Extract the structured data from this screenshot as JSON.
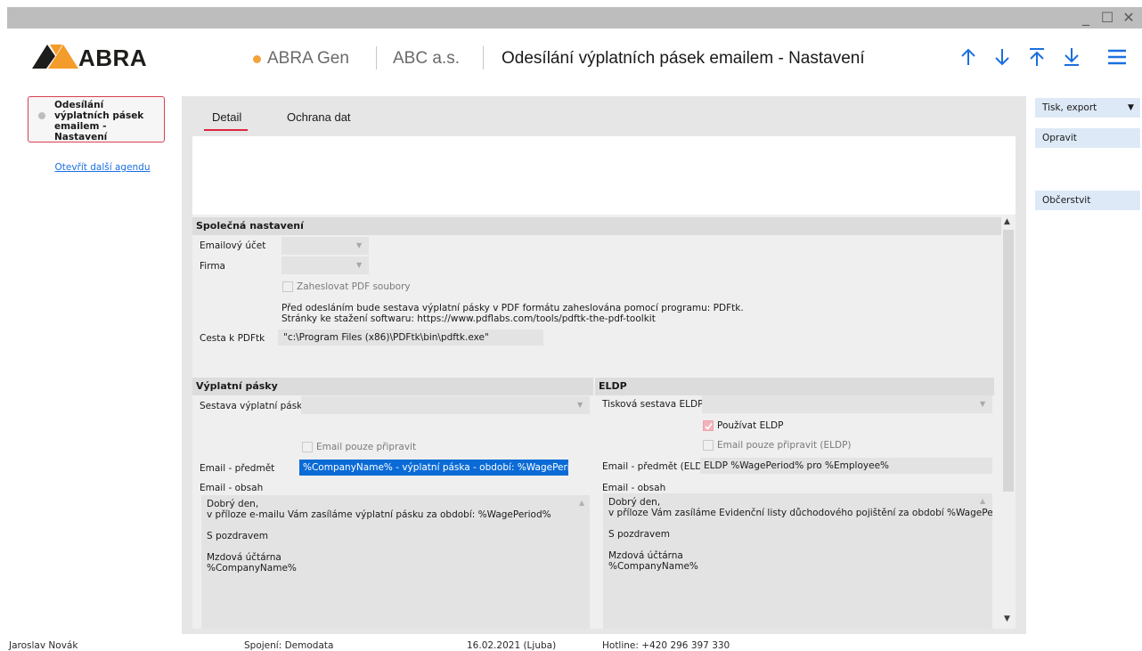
{
  "window": {
    "minimize_glyph": "_",
    "maximize_glyph": "☐",
    "close_glyph": "✕"
  },
  "header": {
    "logo_text": "ABRA",
    "app_name": "ABRA Gen",
    "company": "ABC a.s.",
    "title": "Odesílání výplatních pásek emailem - Nastavení",
    "status_dot_color": "#f3a33a",
    "nav_icons": [
      "arrow-up-icon",
      "arrow-down-icon",
      "arrow-to-top-icon",
      "arrow-to-bottom-icon",
      "hamburger-menu-icon"
    ]
  },
  "sidebar": {
    "active_agenda": "Odesílání výplatních pásek emailem - Nastavení",
    "open_link": "Otevřít další agendu"
  },
  "tabs": [
    {
      "label": "Detail",
      "active": true
    },
    {
      "label": "Ochrana dat",
      "active": false
    }
  ],
  "common": {
    "section_title": "Společná nastavení",
    "email_account_label": "Emailový účet",
    "email_account_value": "",
    "company_label": "Firma",
    "company_value": "",
    "password_pdf_label": "Zaheslovat PDF soubory",
    "info_line1": "Před odesláním bude sestava výplatní pásky v PDF formátu zaheslována pomocí programu: PDFtk.",
    "info_line2": "Stránky ke stažení softwaru: https://www.pdflabs.com/tools/pdftk-the-pdf-toolkit",
    "pdftk_label": "Cesta k PDFtk",
    "pdftk_value": "\"c:\\Program Files (x86)\\PDFtk\\bin\\pdftk.exe\""
  },
  "payslips": {
    "section_title": "Výplatní pásky",
    "report_label": "Sestava výplatní pásky",
    "report_value": "",
    "prepare_only_label": "Email pouze připravit",
    "subject_label": "Email - předmět",
    "subject_value": "%CompanyName% - výplatní páska - období: %WagePeriod%",
    "body_label": "Email - obsah",
    "body_value": "Dobrý den,\nv příloze e-mailu Vám zasíláme výplatní pásku za období: %WagePeriod%\n\nS pozdravem\n\nMzdová účtárna\n%CompanyName%"
  },
  "eldp": {
    "section_title": "ELDP",
    "report_label": "Tisková sestava ELDP",
    "report_value": "",
    "use_eldp_label": "Používat ELDP",
    "use_eldp_checked": true,
    "prepare_only_label": "Email pouze připravit (ELDP)",
    "subject_label": "Email - předmět (ELDP)",
    "subject_value": "ELDP %WagePeriod% pro %Employee%",
    "body_label": "Email - obsah",
    "body_value": "Dobrý den,\nv příloze Vám zasíláme Evidenční listy důchodového pojištění za období %WagePeriod%\n\nS pozdravem\n\nMzdová účtárna\n%CompanyName%"
  },
  "actions": {
    "print_export": "Tisk, export",
    "edit": "Opravit",
    "refresh": "Občerstvit"
  },
  "status_bar": {
    "user": "Jaroslav Novák",
    "connection": "Spojení: Demodata",
    "date": "16.02.2021 (Ljuba)",
    "hotline": "Hotline: +420 296 397 330"
  },
  "colors": {
    "accent_red": "#e0263c",
    "link_blue": "#1b6fe0",
    "action_button_bg": "#dde9f7",
    "selection_bg": "#0a6bd6"
  }
}
